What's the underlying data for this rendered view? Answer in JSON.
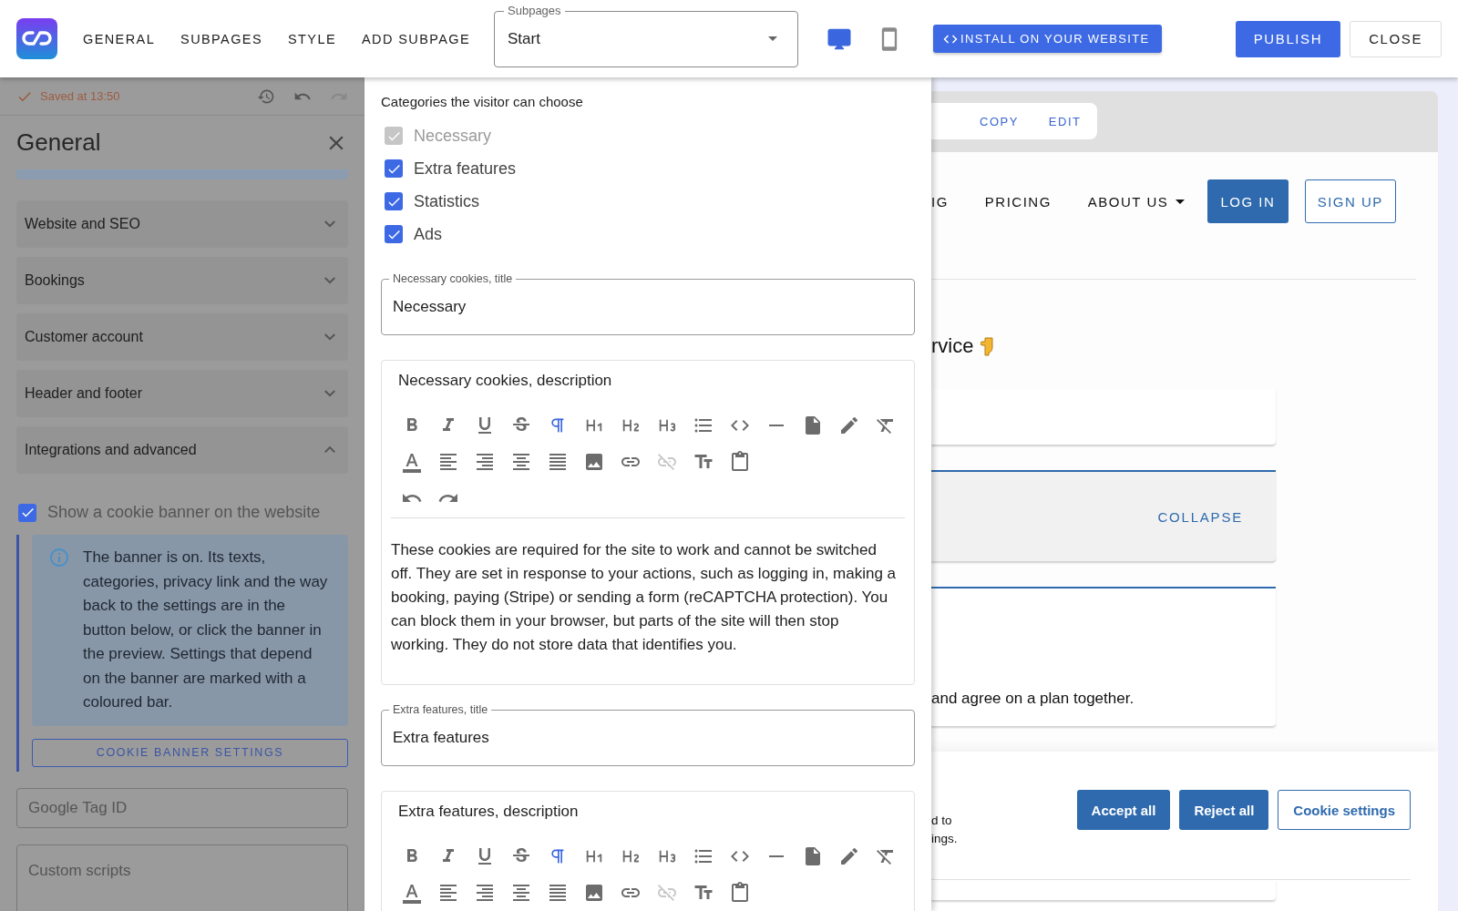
{
  "topbar": {
    "nav": [
      {
        "label": "GENERAL"
      },
      {
        "label": "SUBPAGES"
      },
      {
        "label": "STYLE"
      },
      {
        "label": "ADD SUBPAGE"
      }
    ],
    "subpage_select": {
      "label": "Subpages",
      "value": "Start"
    },
    "devices": [
      {
        "kind": "desktop",
        "selected": true
      },
      {
        "kind": "mobile",
        "selected": false
      }
    ],
    "install_button": "INSTALL ON YOUR WEBSITE",
    "publish_button": "PUBLISH",
    "close_button": "CLOSE"
  },
  "sidebar": {
    "save_status": "Saved at 13:50",
    "title": "General",
    "sections": [
      {
        "label": "Website and SEO",
        "expanded": false
      },
      {
        "label": "Bookings",
        "expanded": false
      },
      {
        "label": "Customer account",
        "expanded": false
      },
      {
        "label": "Header and footer",
        "expanded": false
      },
      {
        "label": "Integrations and advanced",
        "expanded": true
      }
    ],
    "cookie_banner": {
      "label": "Show a cookie banner on the website",
      "checked": true
    },
    "info": "The banner is on. Its texts, categories, privacy link and the way back to the settings are in the button below, or click the banner in the preview. Settings that depend on the banner are marked with a coloured bar.",
    "settings_button": "COOKIE BANNER SETTINGS",
    "fields": [
      {
        "kind": "single",
        "placeholder": "Google Tag ID"
      },
      {
        "kind": "multi",
        "placeholder": "Custom scripts"
      }
    ]
  },
  "editor_panel": {
    "categories_title": "Categories the visitor can choose",
    "categories": [
      {
        "label": "Necessary",
        "checked": true,
        "disabled": true
      },
      {
        "label": "Extra features",
        "checked": true,
        "disabled": false
      },
      {
        "label": "Statistics",
        "checked": true,
        "disabled": false
      },
      {
        "label": "Ads",
        "checked": true,
        "disabled": false
      }
    ],
    "blocks": [
      {
        "kind": "field",
        "label": "Necessary cookies, title",
        "value": "Necessary"
      },
      {
        "kind": "rich",
        "title": "Necessary cookies, description",
        "paragraph_active": true,
        "unlink_disabled": true,
        "history_buttons": true,
        "text": "These cookies are required for the site to work and cannot be switched off. They are set in response to your actions, such as logging in, making a booking, paying (Stripe) or sending a form (reCAPTCHA protection). You can block them in your browser, but parts of the site will then stop working. They do not store data that identifies you."
      },
      {
        "kind": "field",
        "label": "Extra features, title",
        "value": "Extra features"
      },
      {
        "kind": "rich",
        "title": "Extra features, description",
        "paragraph_active": true,
        "unlink_disabled": true
      }
    ]
  },
  "preview": {
    "actions": [
      {
        "label": "COPY"
      },
      {
        "label": "EDIT"
      }
    ],
    "nav": [
      {
        "label": "IG",
        "kind": "link"
      },
      {
        "label": "PRICING",
        "kind": "link"
      },
      {
        "label": "ABOUT US",
        "kind": "dropdown"
      }
    ],
    "login_button": "LOG IN",
    "signup_button": "SIGN UP",
    "heading": "rvice",
    "cards": [
      {
        "kind": "plain"
      },
      {
        "kind": "action",
        "action": "COLLAPSE"
      },
      {
        "kind": "text",
        "text": "and agree on a plan together."
      }
    ],
    "cookie_banner": {
      "text": "d to\nings.",
      "buttons": [
        {
          "label": "Accept all",
          "kind": "filled"
        },
        {
          "label": "Reject all",
          "kind": "filled"
        },
        {
          "label": "Cookie settings",
          "kind": "outlined"
        }
      ]
    }
  }
}
